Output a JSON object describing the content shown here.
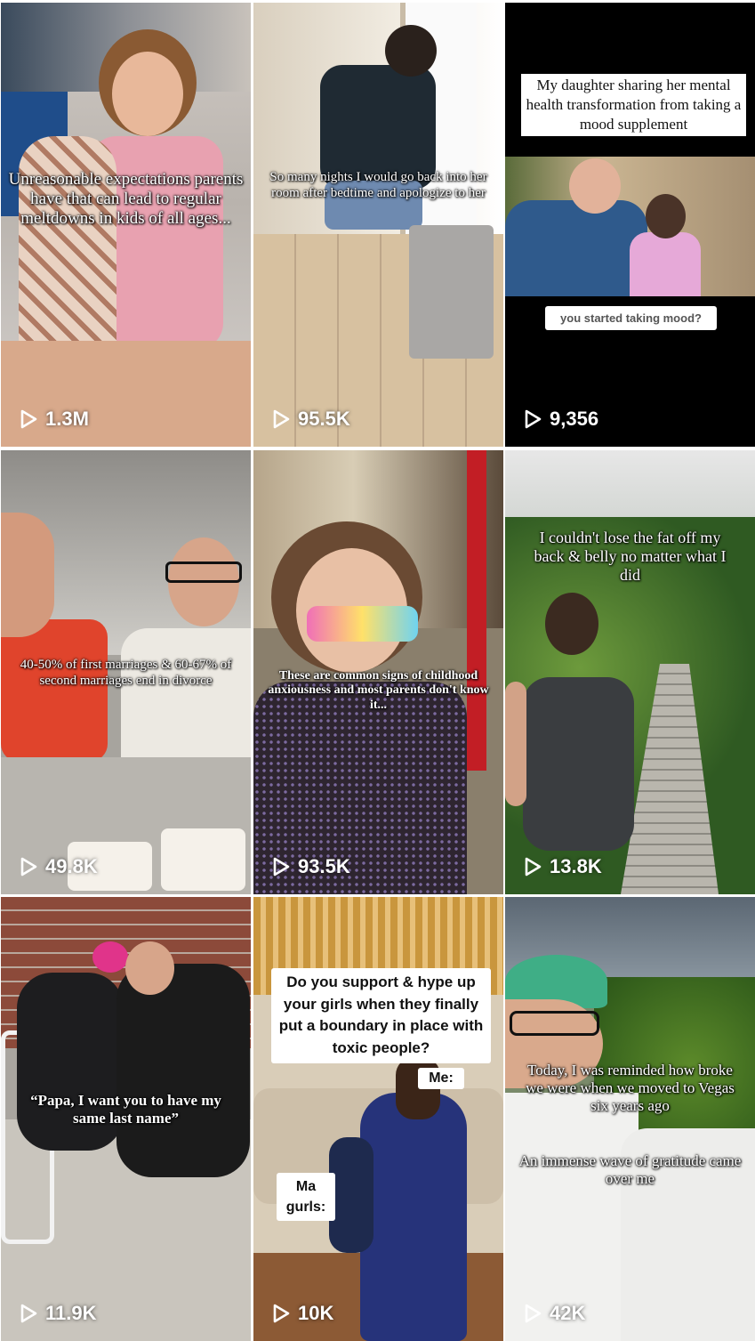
{
  "videos": [
    {
      "caption": "Unreasonable expectations parents have that can lead to regular meltdowns in kids of all ages...",
      "views": "1.3M"
    },
    {
      "caption": "So many nights I would go back into her room after bedtime and apologize to her",
      "views": "95.5K"
    },
    {
      "caption": "My daughter sharing her mental health transformation from taking a mood supplement",
      "subcaption": "you started taking mood?",
      "views": "9,356"
    },
    {
      "caption": "40-50% of first marriages & 60-67% of second marriages end in divorce",
      "views": "49.8K"
    },
    {
      "caption": "These are common signs of childhood anxiousness and most parents don't know it...",
      "views": "93.5K"
    },
    {
      "caption": "I couldn't lose the fat off my back & belly no matter what I did",
      "views": "13.8K"
    },
    {
      "caption": "“Papa, I want you to have my same last name”",
      "views": "11.9K"
    },
    {
      "caption": "Do you support & hype up your girls when they finally put a boundary in place with toxic people?",
      "label_me": "Me:",
      "label_ma": "Ma gurls:",
      "views": "10K"
    },
    {
      "caption": "Today, I was reminded how broke we were when we moved to Vegas six years ago",
      "caption2": "An immense wave of gratitude came over me",
      "views": "42K"
    }
  ]
}
